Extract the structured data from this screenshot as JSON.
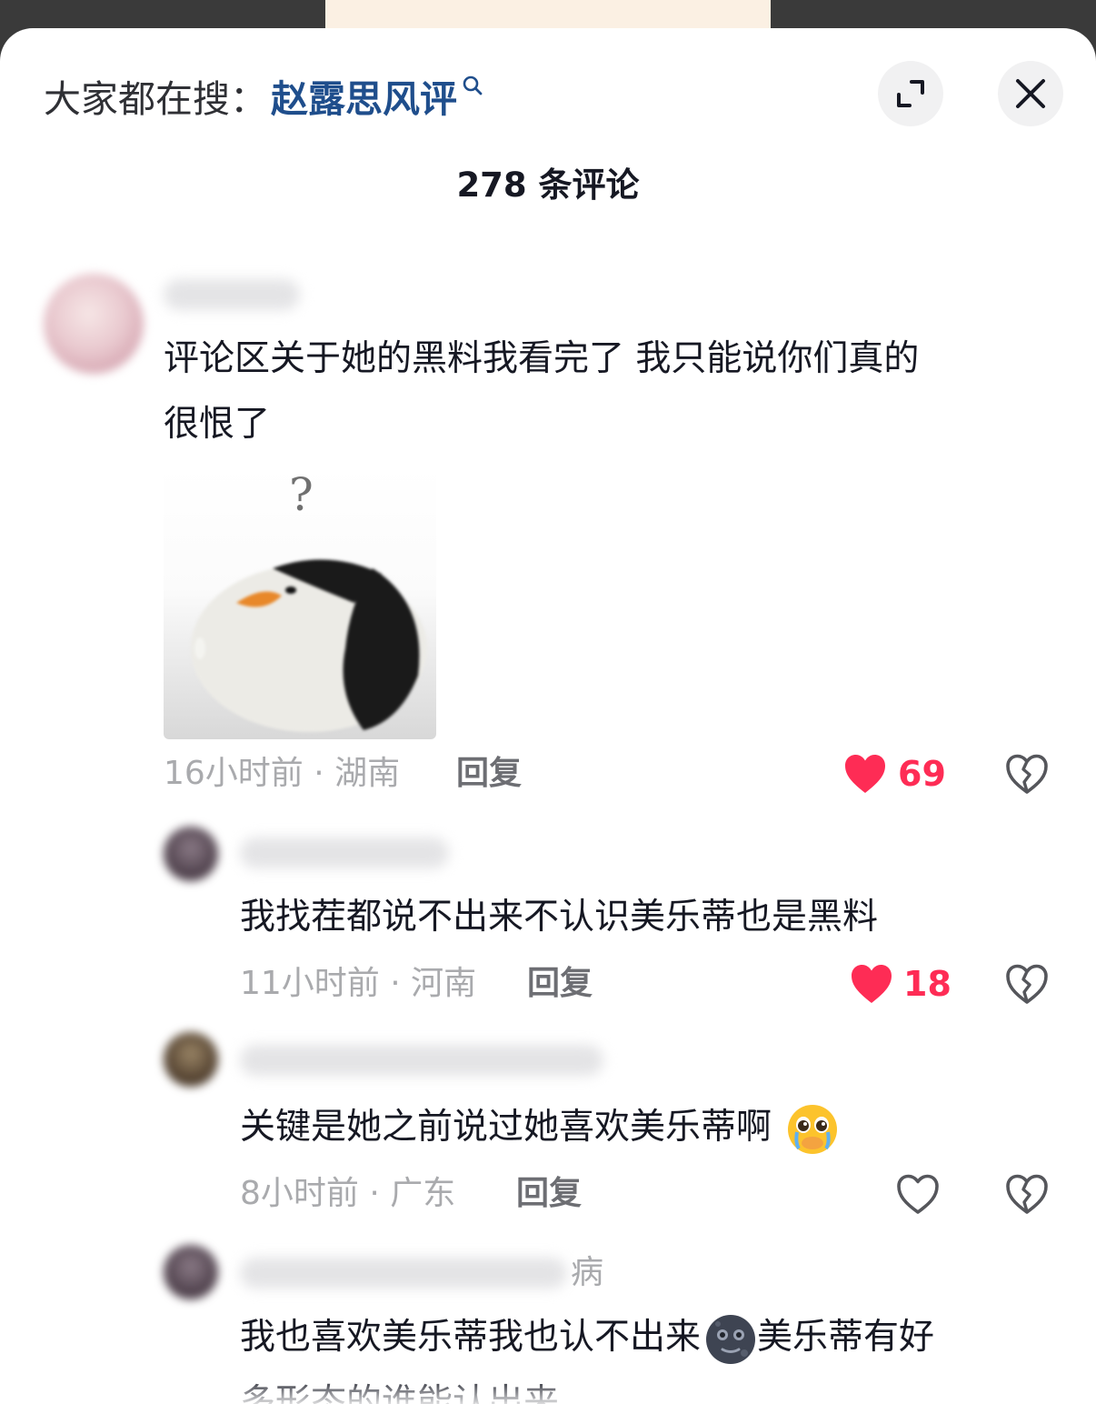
{
  "header": {
    "search_prefix": "大家都在搜：",
    "search_term": "赵露思风评",
    "comment_count": "278 条评论"
  },
  "icons": {
    "search": "search-icon",
    "expand": "expand-icon",
    "close": "close-icon",
    "like": "heart-icon",
    "dislike": "broken-heart-icon"
  },
  "colors": {
    "accent_like": "#fe2c55",
    "search_term": "#1f4e8c",
    "meta_text": "#a9aaad"
  },
  "comments": [
    {
      "text_line1": "评论区关于她的黑料我看完了 我只能说你们真的",
      "text_line2": "很恨了",
      "sticker_text": "?",
      "time_location": "16小时前 · 湖南",
      "reply_label": "回复",
      "likes": "69",
      "liked": true
    },
    {
      "text": "我找茬都说不出来不认识美乐蒂也是黑料",
      "time_location": "11小时前 · 河南",
      "reply_label": "回复",
      "likes": "18",
      "liked": true
    },
    {
      "text": "关键是她之前说过她喜欢美乐蒂啊",
      "emoji": "pleading-face-emoji",
      "time_location": "8小时前 · 广东",
      "reply_label": "回复",
      "likes": "",
      "liked": false
    },
    {
      "name_suffix": "病",
      "text_line1a": "我也喜欢美乐蒂我也认不出来",
      "emoji": "new-moon-face-emoji",
      "text_line1b": "美乐蒂有好",
      "text_line2": "多形态的谁能认出来"
    }
  ]
}
